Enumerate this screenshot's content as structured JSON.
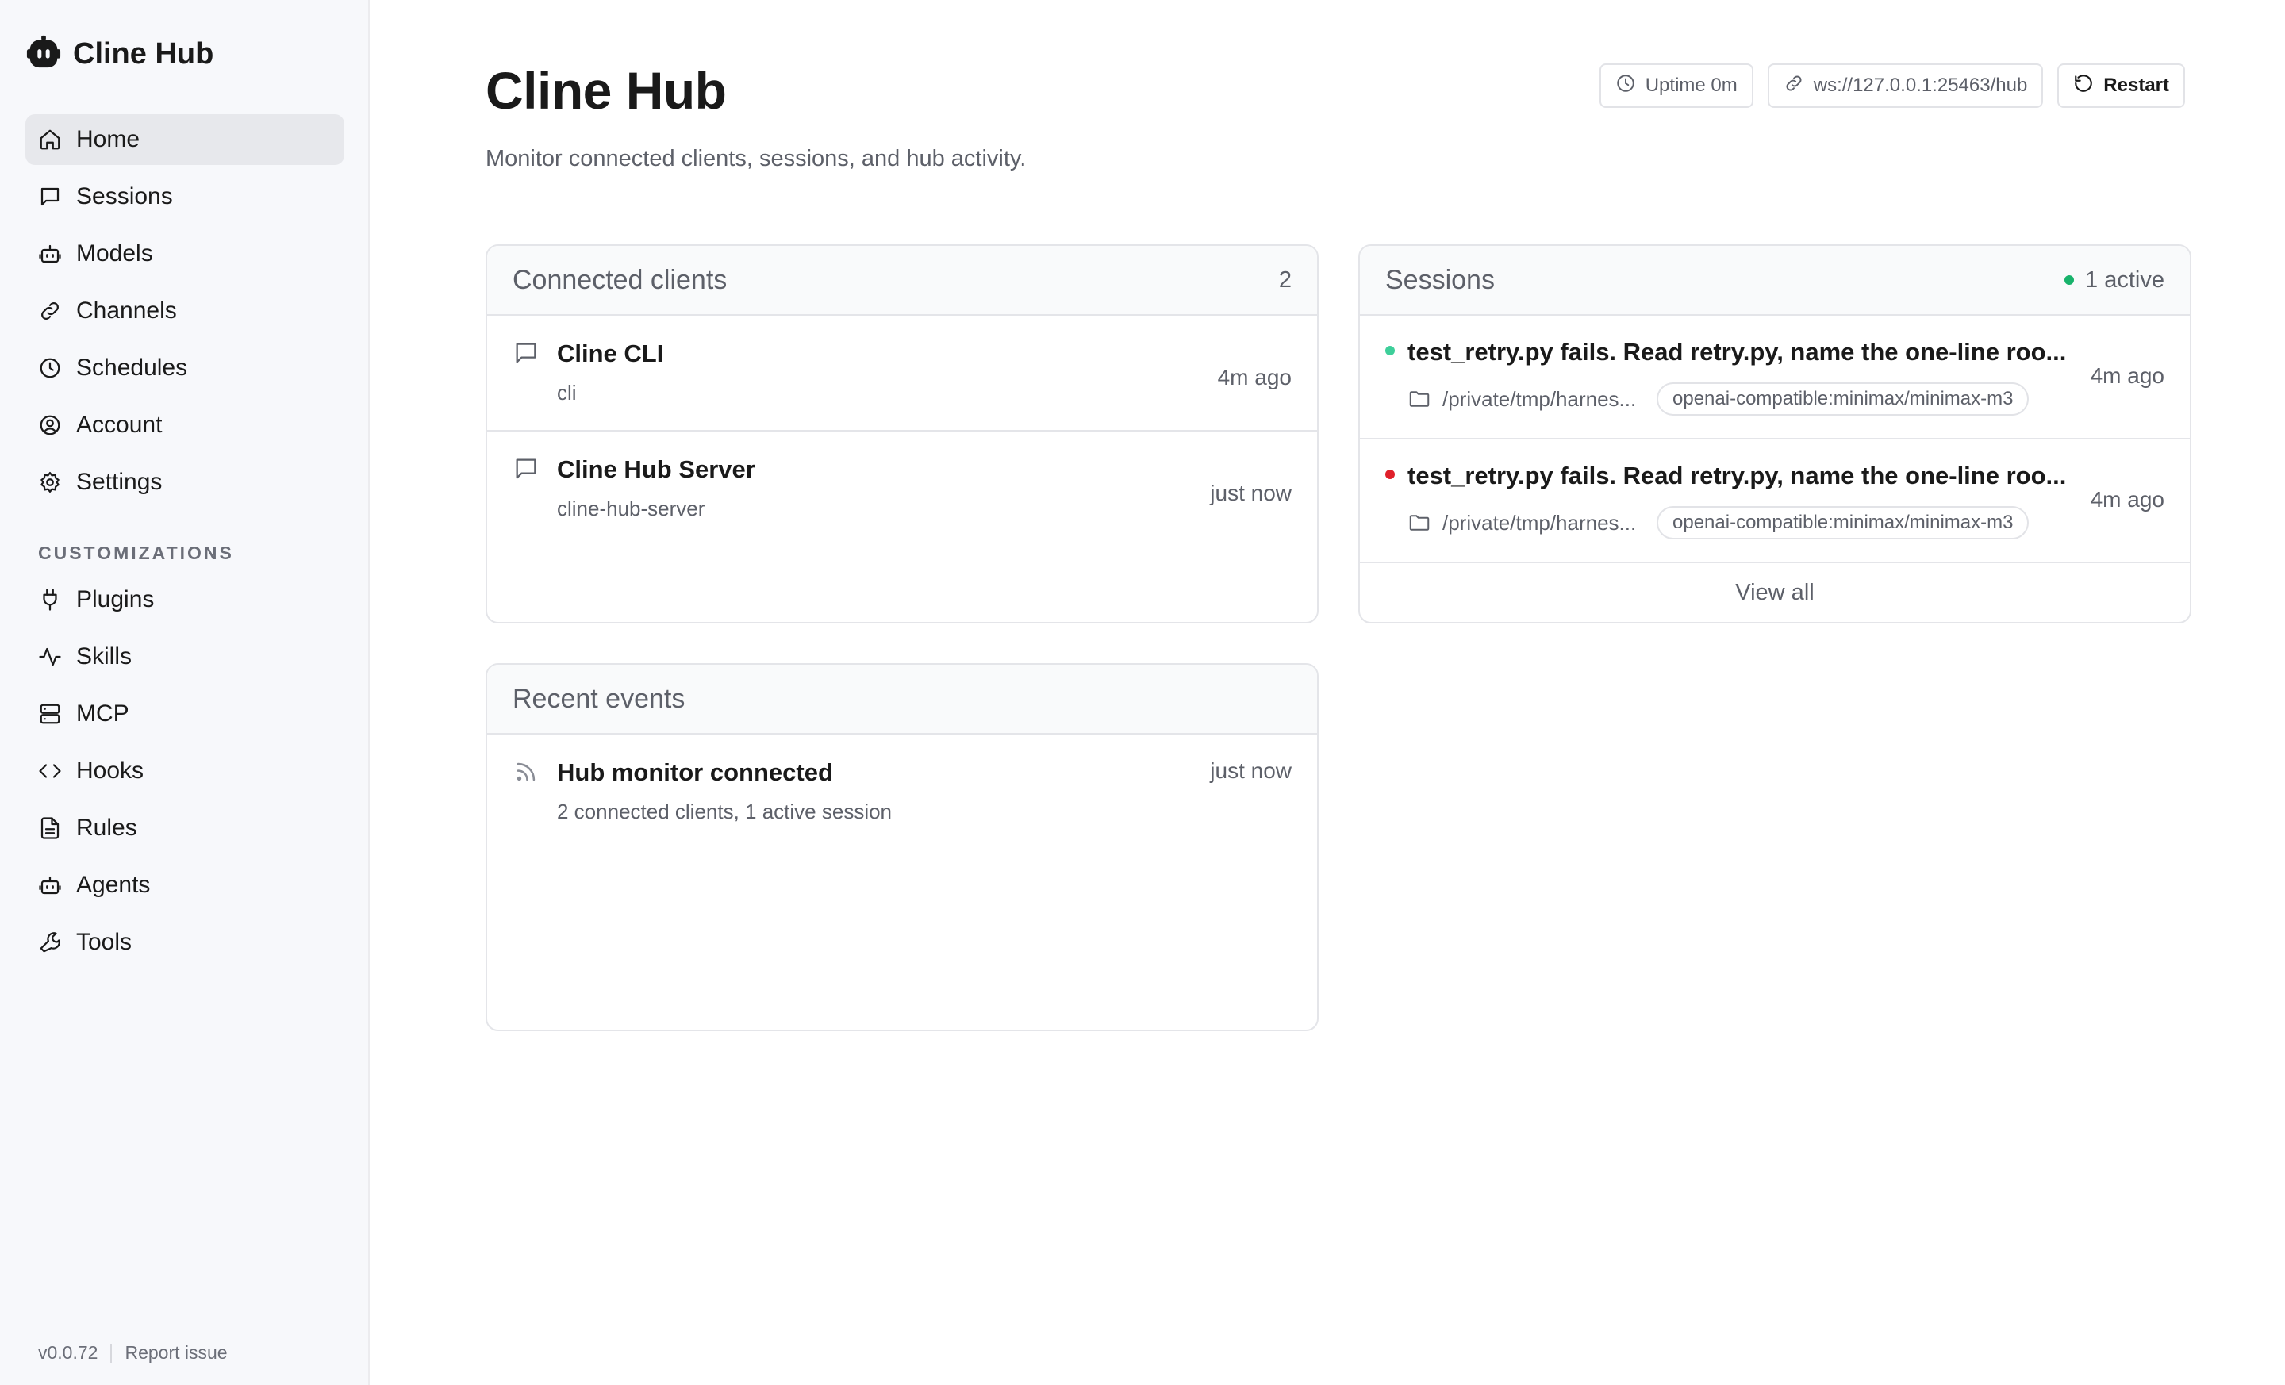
{
  "app": {
    "name": "Cline Hub",
    "version": "v0.0.72",
    "report_issue": "Report issue"
  },
  "sidebar": {
    "items": [
      {
        "label": "Home",
        "icon": "home-icon",
        "active": true
      },
      {
        "label": "Sessions",
        "icon": "chat-icon"
      },
      {
        "label": "Models",
        "icon": "robot-icon"
      },
      {
        "label": "Channels",
        "icon": "link-icon"
      },
      {
        "label": "Schedules",
        "icon": "clock-icon"
      },
      {
        "label": "Account",
        "icon": "user-circle-icon"
      },
      {
        "label": "Settings",
        "icon": "gear-icon"
      }
    ],
    "section_label": "CUSTOMIZATIONS",
    "custom_items": [
      {
        "label": "Plugins",
        "icon": "plug-icon"
      },
      {
        "label": "Skills",
        "icon": "activity-icon"
      },
      {
        "label": "MCP",
        "icon": "server-icon"
      },
      {
        "label": "Hooks",
        "icon": "code-icon"
      },
      {
        "label": "Rules",
        "icon": "document-icon"
      },
      {
        "label": "Agents",
        "icon": "robot-icon"
      },
      {
        "label": "Tools",
        "icon": "wrench-icon"
      }
    ]
  },
  "header": {
    "title": "Cline Hub",
    "subtitle": "Monitor connected clients, sessions, and hub activity.",
    "uptime": "Uptime 0m",
    "ws_url": "ws://127.0.0.1:25463/hub",
    "restart_label": "Restart"
  },
  "clients": {
    "title": "Connected clients",
    "count": "2",
    "items": [
      {
        "name": "Cline CLI",
        "id": "cli",
        "time": "4m ago"
      },
      {
        "name": "Cline Hub Server",
        "id": "cline-hub-server",
        "time": "just now"
      }
    ]
  },
  "sessions": {
    "title": "Sessions",
    "active_label": "1 active",
    "items": [
      {
        "title": "test_retry.py fails. Read retry.py, name the one-line roo...",
        "path": "/private/tmp/harnes...",
        "model": "openai-compatible:minimax/minimax-m3",
        "time": "4m ago",
        "status_color": "#3ecf9a"
      },
      {
        "title": "test_retry.py fails. Read retry.py, name the one-line roo...",
        "path": "/private/tmp/harnes...",
        "model": "openai-compatible:minimax/minimax-m3",
        "time": "4m ago",
        "status_color": "#e0202a"
      }
    ],
    "view_all": "View all"
  },
  "events": {
    "title": "Recent events",
    "items": [
      {
        "title": "Hub monitor connected",
        "detail": "2 connected clients, 1 active session",
        "time": "just now"
      }
    ]
  },
  "colors": {
    "active_green": "#18b26b"
  }
}
